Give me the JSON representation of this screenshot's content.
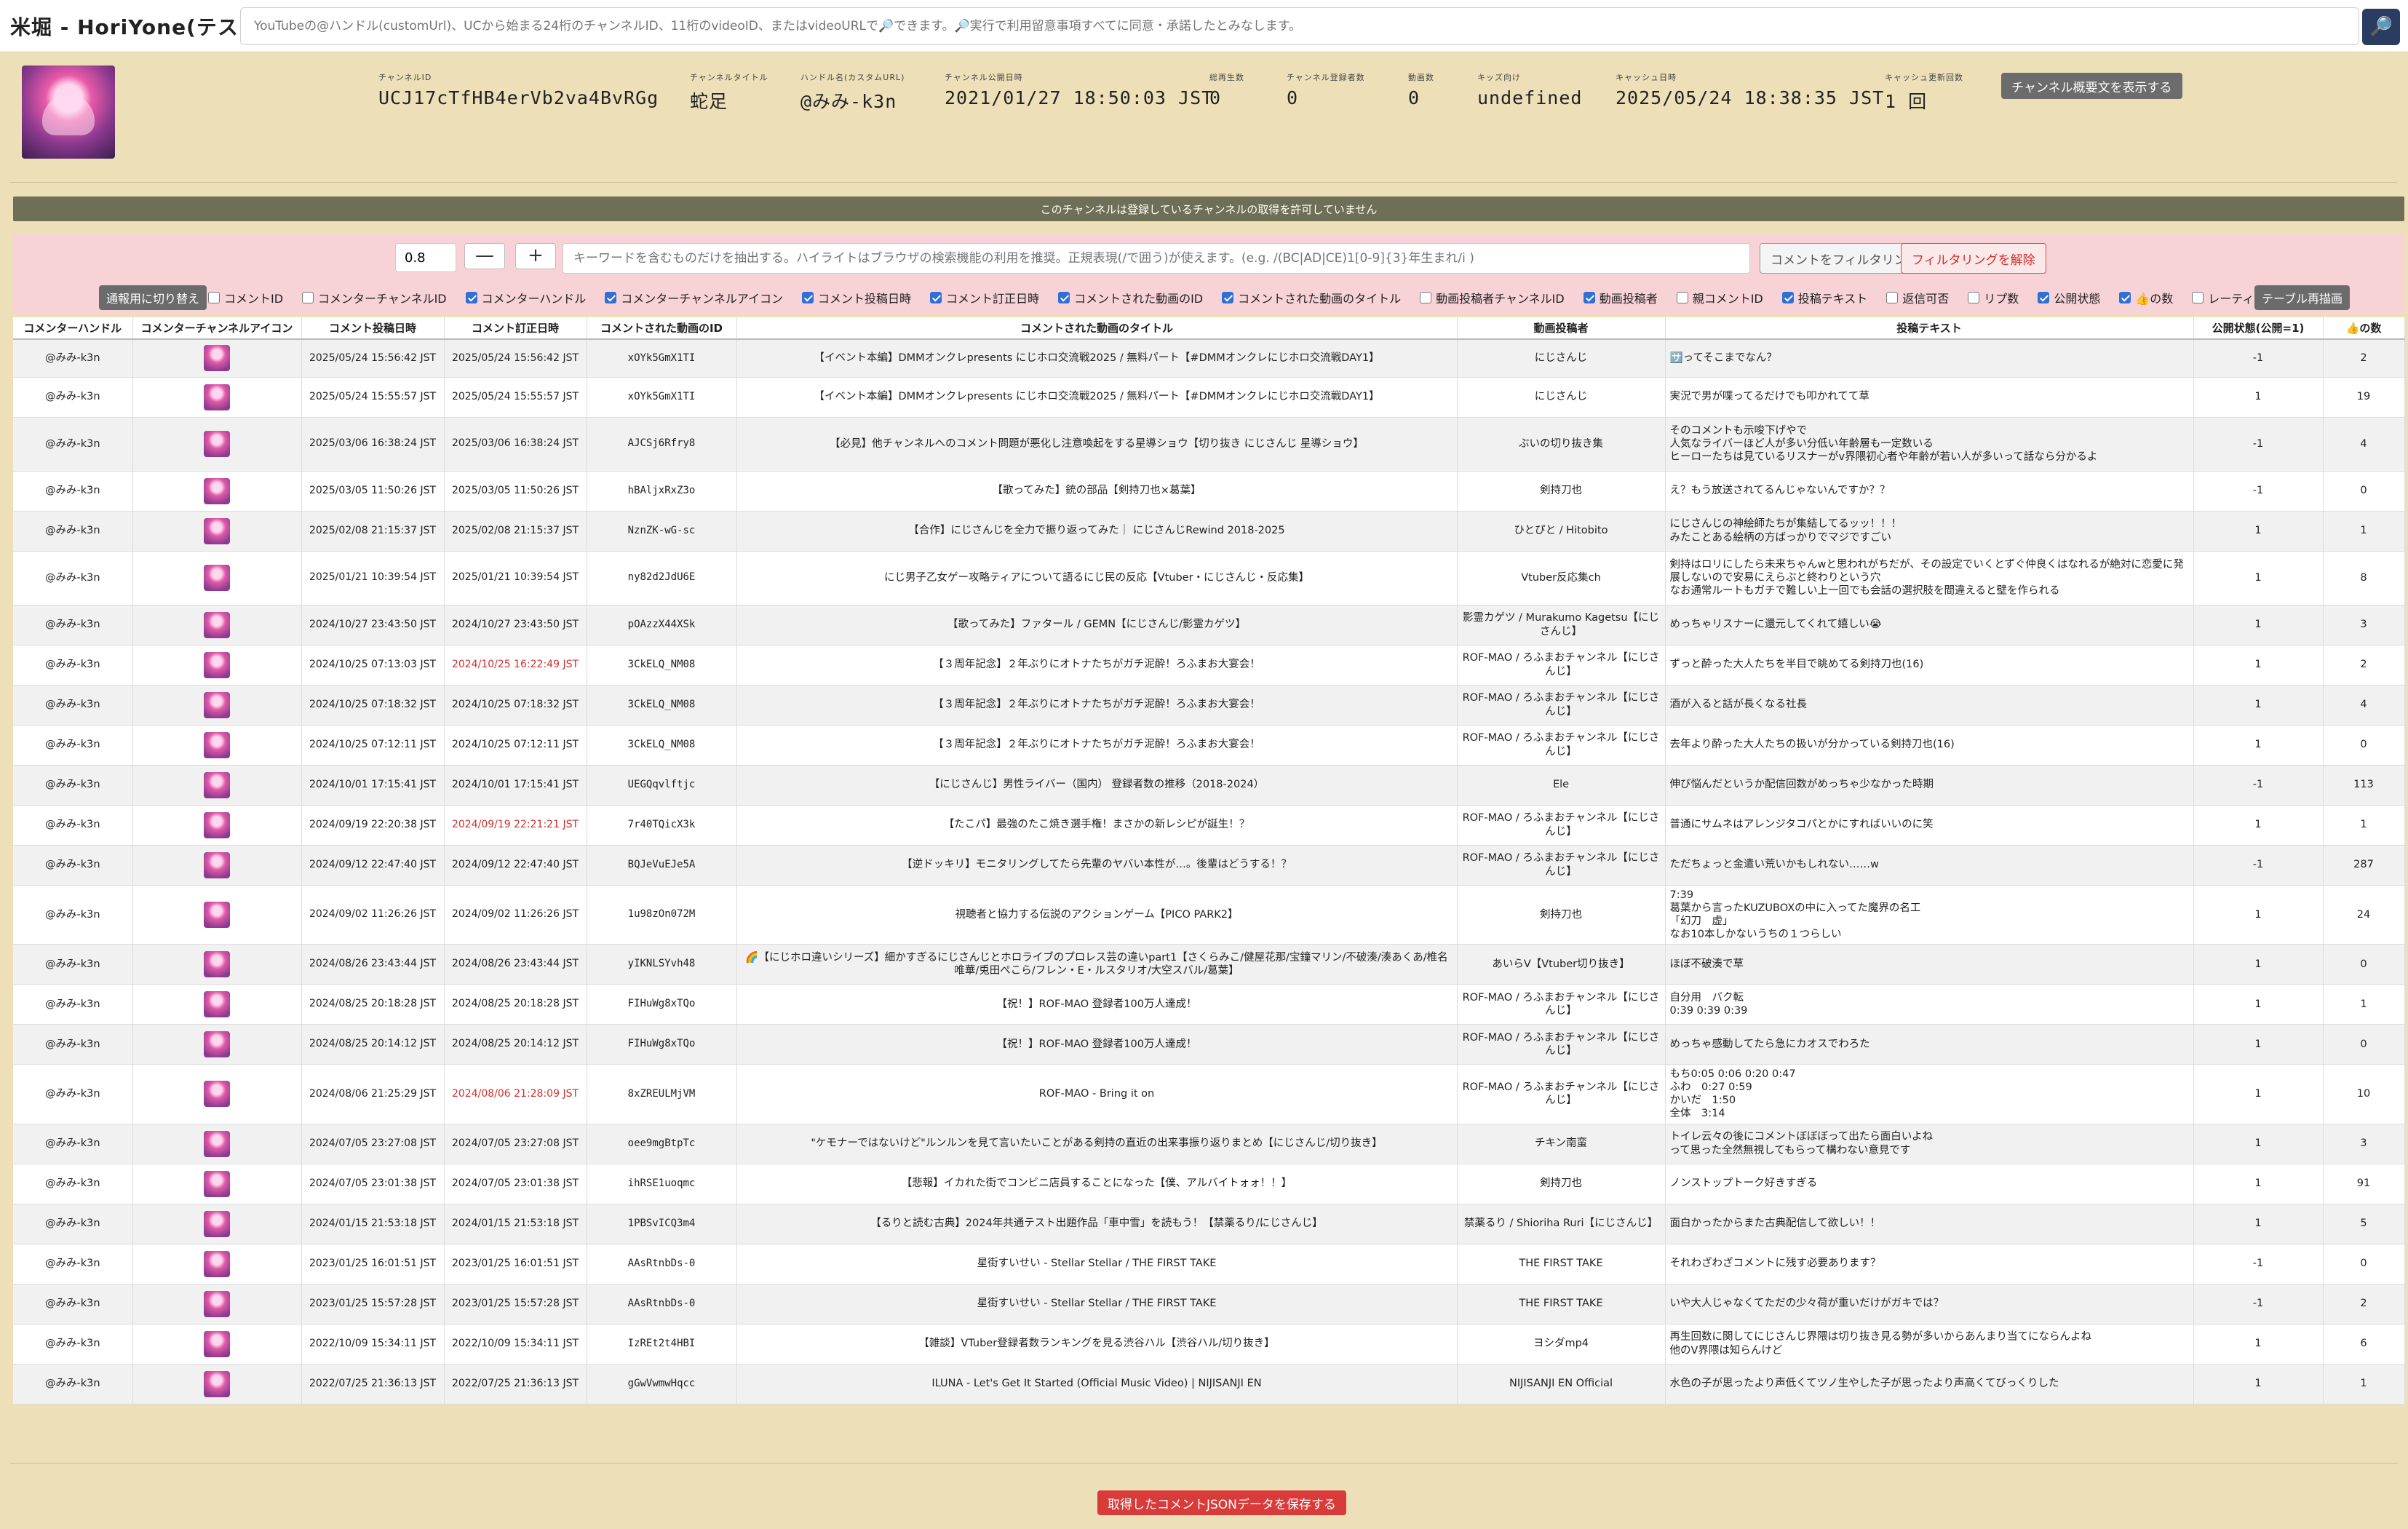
{
  "app": {
    "title": "米堀 - HoriYone(テスト中)"
  },
  "search": {
    "placeholder": "YouTubeの@ハンドル(customUrl)、UCから始まる24桁のチャンネルID、11桁のvideoID、またはvideoURLで🔎できます。🔎実行で利用留意事項すべてに同意・承諾したとみなします。",
    "button_icon": "🔎"
  },
  "channel": {
    "items": [
      {
        "label": "チャンネルID",
        "value": "UCJ17cTfHB4erVb2va4BvRGg"
      },
      {
        "label": "チャンネルタイトル",
        "value": "蛇足"
      },
      {
        "label": "ハンドル名(カスタムURL)",
        "value": "@みみ-k3n"
      },
      {
        "label": "チャンネル公開日時",
        "value": "2021/01/27 18:50:03 JST"
      },
      {
        "label": "総再生数",
        "value": "0"
      },
      {
        "label": "チャンネル登録者数",
        "value": "0"
      },
      {
        "label": "動画数",
        "value": "0"
      },
      {
        "label": "キッズ向け",
        "value": "undefined"
      },
      {
        "label": "キャッシュ日時",
        "value": "2025/05/24 18:38:35 JST"
      },
      {
        "label": "キャッシュ更新回数",
        "value": "1 回"
      }
    ],
    "desc_button": "チャンネル概要文を表示する"
  },
  "notice": "このチャンネルは登録しているチャンネルの取得を許可していません",
  "filter": {
    "zoom": "0.8",
    "minus": "—",
    "plus": "+",
    "keyword_placeholder": "キーワードを含むものだけを抽出する。ハイライトはブラウザの検索機能の利用を推奨。正規表現(/で囲う)が使えます。(e.g. /(BC|AD|CE)1[0-9]{3}年生まれ/i )",
    "filter_button": "コメントをフィルタリング",
    "unfilter_button": "フィルタリングを解除",
    "toggle_button": "通報用に切り替え",
    "redraw_button": "テーブル再描画",
    "options": [
      {
        "label": "コメントID",
        "checked": false
      },
      {
        "label": "コメンターチャンネルID",
        "checked": false
      },
      {
        "label": "コメンターハンドル",
        "checked": true
      },
      {
        "label": "コメンターチャンネルアイコン",
        "checked": true
      },
      {
        "label": "コメント投稿日時",
        "checked": true
      },
      {
        "label": "コメント訂正日時",
        "checked": true
      },
      {
        "label": "コメントされた動画のID",
        "checked": true
      },
      {
        "label": "コメントされた動画のタイトル",
        "checked": true
      },
      {
        "label": "動画投稿者チャンネルID",
        "checked": false
      },
      {
        "label": "動画投稿者",
        "checked": true
      },
      {
        "label": "親コメントID",
        "checked": false
      },
      {
        "label": "投稿テキスト",
        "checked": true
      },
      {
        "label": "返信可否",
        "checked": false
      },
      {
        "label": "リプ数",
        "checked": false
      },
      {
        "label": "公開状態",
        "checked": true
      },
      {
        "label": "👍の数",
        "checked": true
      },
      {
        "label": "レーティング",
        "checked": false
      }
    ]
  },
  "table": {
    "headers": [
      "コメンターハンドル",
      "コメンターチャンネルアイコン",
      "コメント投稿日時",
      "コメント訂正日時",
      "コメントされた動画のID",
      "コメントされた動画のタイトル",
      "動画投稿者",
      "投稿テキスト",
      "公開状態(公開=1)",
      "👍の数"
    ],
    "rows": [
      {
        "handle": "@みみ-k3n",
        "posted": "2025/05/24 15:56:42 JST",
        "edited": "2025/05/24 15:56:42 JST",
        "edited_red": false,
        "video_id": "xOYk5GmX1TI",
        "title": "【イベント本編】DMMオンクレpresents にじホロ交流戦2025 / 無料パート【#DMMオンクレにじホロ交流戦DAY1】",
        "uploader": "にじさんじ",
        "text": [
          "🈂️ってそこまでなん？"
        ],
        "public": "-1",
        "likes": "2"
      },
      {
        "handle": "@みみ-k3n",
        "posted": "2025/05/24 15:55:57 JST",
        "edited": "2025/05/24 15:55:57 JST",
        "edited_red": false,
        "video_id": "xOYk5GmX1TI",
        "title": "【イベント本編】DMMオンクレpresents にじホロ交流戦2025 / 無料パート【#DMMオンクレにじホロ交流戦DAY1】",
        "uploader": "にじさんじ",
        "text": [
          "実況で男が喋ってるだけでも叩かれてて草"
        ],
        "public": "1",
        "likes": "19"
      },
      {
        "handle": "@みみ-k3n",
        "posted": "2025/03/06 16:38:24 JST",
        "edited": "2025/03/06 16:38:24 JST",
        "edited_red": false,
        "video_id": "AJCSj6Rfry8",
        "title": "【必見】他チャンネルへのコメント問題が悪化し注意喚起をする星導ショウ【切り抜き にじさんじ 星導ショウ】",
        "uploader": "ぶいの切り抜き集",
        "text": [
          "そのコメントも示唆下げやで",
          "人気なライバーほど人が多い分低い年齢層も一定数いる",
          "ヒーローたちは見ているリスナーがv界隈初心者や年齢が若い人が多いって話なら分かるよ"
        ],
        "public": "-1",
        "likes": "4"
      },
      {
        "handle": "@みみ-k3n",
        "posted": "2025/03/05 11:50:26 JST",
        "edited": "2025/03/05 11:50:26 JST",
        "edited_red": false,
        "video_id": "hBAljxRxZ3o",
        "title": "【歌ってみた】銃の部品【剣持刀也×葛葉】",
        "uploader": "剣持刀也",
        "text": [
          "え？もう放送されてるんじゃないんですか？？"
        ],
        "public": "-1",
        "likes": "0"
      },
      {
        "handle": "@みみ-k3n",
        "posted": "2025/02/08 21:15:37 JST",
        "edited": "2025/02/08 21:15:37 JST",
        "edited_red": false,
        "video_id": "NznZK-wG-sc",
        "title": "【合作】にじさんじを全力で振り返ってみた｜ にじさんじRewind 2018-2025",
        "uploader": "ひとぴと / Hitobito",
        "text": [
          "にじさんじの神絵師たちが集結してるッッ！！！",
          "みたことある絵柄の方ばっかりでマジですごい"
        ],
        "public": "1",
        "likes": "1"
      },
      {
        "handle": "@みみ-k3n",
        "posted": "2025/01/21 10:39:54 JST",
        "edited": "2025/01/21 10:39:54 JST",
        "edited_red": false,
        "video_id": "ny82d2JdU6E",
        "title": "にじ男子乙女ゲー攻略ティアについて語るにじ民の反応【Vtuber・にじさんじ・反応集】",
        "uploader": "Vtuber反応集ch",
        "text": [
          "剣持はロリにしたら未来ちゃんwと思われがちだが、その設定でいくとずぐ仲良くはなれるが絶対に恋愛に発展しないので安易にえらぶと終わりという穴",
          "なお通常ルートもガチで難しい上一回でも会話の選択肢を間違えると壁を作られる"
        ],
        "public": "1",
        "likes": "8"
      },
      {
        "handle": "@みみ-k3n",
        "posted": "2024/10/27 23:43:50 JST",
        "edited": "2024/10/27 23:43:50 JST",
        "edited_red": false,
        "video_id": "pOAzzX44XSk",
        "title": "【歌ってみた】ファタール / GEMN【にじさんじ/影霊カゲツ】",
        "uploader": "影霊カゲツ / Murakumo Kagetsu【にじさんじ】",
        "text": [
          "めっちゃリスナーに還元してくれて嬉しい😭"
        ],
        "public": "1",
        "likes": "3"
      },
      {
        "handle": "@みみ-k3n",
        "posted": "2024/10/25 07:13:03 JST",
        "edited": "2024/10/25 16:22:49 JST",
        "edited_red": true,
        "video_id": "3CkELQ_NM08",
        "title": "【３周年記念】２年ぶりにオトナたちがガチ泥酔！ろふまお大宴会！",
        "uploader": "ROF-MAO / ろふまおチャンネル【にじさんじ】",
        "text": [
          "ずっと酔った大人たちを半目で眺めてる剣持刀也(16)"
        ],
        "public": "1",
        "likes": "2"
      },
      {
        "handle": "@みみ-k3n",
        "posted": "2024/10/25 07:18:32 JST",
        "edited": "2024/10/25 07:18:32 JST",
        "edited_red": false,
        "video_id": "3CkELQ_NM08",
        "title": "【３周年記念】２年ぶりにオトナたちがガチ泥酔！ろふまお大宴会！",
        "uploader": "ROF-MAO / ろふまおチャンネル【にじさんじ】",
        "text": [
          "酒が入ると話が長くなる社長"
        ],
        "public": "1",
        "likes": "4"
      },
      {
        "handle": "@みみ-k3n",
        "posted": "2024/10/25 07:12:11 JST",
        "edited": "2024/10/25 07:12:11 JST",
        "edited_red": false,
        "video_id": "3CkELQ_NM08",
        "title": "【３周年記念】２年ぶりにオトナたちがガチ泥酔！ろふまお大宴会！",
        "uploader": "ROF-MAO / ろふまおチャンネル【にじさんじ】",
        "text": [
          "去年より酔った大人たちの扱いが分かっている剣持刀也(16)"
        ],
        "public": "1",
        "likes": "0"
      },
      {
        "handle": "@みみ-k3n",
        "posted": "2024/10/01 17:15:41 JST",
        "edited": "2024/10/01 17:15:41 JST",
        "edited_red": false,
        "video_id": "UEGQqvlftjc",
        "title": "【にじさんじ】男性ライバー（国内） 登録者数の推移（2018-2024）",
        "uploader": "Ele",
        "text": [
          "伸び悩んだというか配信回数がめっちゃ少なかった時期"
        ],
        "public": "-1",
        "likes": "113"
      },
      {
        "handle": "@みみ-k3n",
        "posted": "2024/09/19 22:20:38 JST",
        "edited": "2024/09/19 22:21:21 JST",
        "edited_red": true,
        "video_id": "7r40TQicX3k",
        "title": "【たこパ】最強のたこ焼き選手権！まさかの新レシピが誕生！？",
        "uploader": "ROF-MAO / ろふまおチャンネル【にじさんじ】",
        "text": [
          "普通にサムネはアレンジタコパとかにすればいいのに笑"
        ],
        "public": "1",
        "likes": "1"
      },
      {
        "handle": "@みみ-k3n",
        "posted": "2024/09/12 22:47:40 JST",
        "edited": "2024/09/12 22:47:40 JST",
        "edited_red": false,
        "video_id": "BQJeVuEJe5A",
        "title": "【逆ドッキリ】モニタリングしてたら先輩のヤバい本性が…。後輩はどうする！？",
        "uploader": "ROF-MAO / ろふまおチャンネル【にじさんじ】",
        "text": [
          "ただちょっと金遣い荒いかもしれない……w"
        ],
        "public": "-1",
        "likes": "287"
      },
      {
        "handle": "@みみ-k3n",
        "posted": "2024/09/02 11:26:26 JST",
        "edited": "2024/09/02 11:26:26 JST",
        "edited_red": false,
        "video_id": "1u98zOn072M",
        "title": "視聴者と協力する伝説のアクションゲーム【PICO PARK2】",
        "uploader": "剣持刀也",
        "text": [
          "7:39",
          "葛葉から言ったKUZUBOXの中に入ってた魔界の名工",
          "「幻刀　虚」",
          "なお10本しかないうちの１つらしい"
        ],
        "public": "1",
        "likes": "24"
      },
      {
        "handle": "@みみ-k3n",
        "posted": "2024/08/26 23:43:44 JST",
        "edited": "2024/08/26 23:43:44 JST",
        "edited_red": false,
        "video_id": "yIKNLSYvh48",
        "title": "🌈【にじホロ違いシリーズ】細かすぎるにじさんじとホロライブのプロレス芸の違いpart1【さくらみこ/健屋花那/宝鐘マリン/不破湊/湊あくあ/椎名唯華/兎田ぺこら/フレン・E・ルスタリオ/大空スバル/葛葉】",
        "uploader": "あいらV【Vtuber切り抜き】",
        "text": [
          "ほぼ不破湊で草"
        ],
        "public": "1",
        "likes": "0"
      },
      {
        "handle": "@みみ-k3n",
        "posted": "2024/08/25 20:18:28 JST",
        "edited": "2024/08/25 20:18:28 JST",
        "edited_red": false,
        "video_id": "FIHuWg8xTQo",
        "title": "【祝！】ROF-MAO 登録者100万人達成！",
        "uploader": "ROF-MAO / ろふまおチャンネル【にじさんじ】",
        "text": [
          "自分用　バク転",
          "0:39 0:39 0:39"
        ],
        "public": "1",
        "likes": "1"
      },
      {
        "handle": "@みみ-k3n",
        "posted": "2024/08/25 20:14:12 JST",
        "edited": "2024/08/25 20:14:12 JST",
        "edited_red": false,
        "video_id": "FIHuWg8xTQo",
        "title": "【祝！】ROF-MAO 登録者100万人達成！",
        "uploader": "ROF-MAO / ろふまおチャンネル【にじさんじ】",
        "text": [
          "めっちゃ感動してたら急にカオスでわろた"
        ],
        "public": "1",
        "likes": "0"
      },
      {
        "handle": "@みみ-k3n",
        "posted": "2024/08/06 21:25:29 JST",
        "edited": "2024/08/06 21:28:09 JST",
        "edited_red": true,
        "video_id": "8xZREULMjVM",
        "title": "ROF-MAO - Bring it on",
        "uploader": "ROF-MAO / ろふまおチャンネル【にじさんじ】",
        "text": [
          "もち0:05 0:06 0:20 0:47",
          "ふわ　0:27 0:59",
          "かいだ　1:50",
          "全体　3:14"
        ],
        "public": "1",
        "likes": "10"
      },
      {
        "handle": "@みみ-k3n",
        "posted": "2024/07/05 23:27:08 JST",
        "edited": "2024/07/05 23:27:08 JST",
        "edited_red": false,
        "video_id": "oee9mgBtpTc",
        "title": "\"ケモナーではないけど\"ルンルンを見て言いたいことがある剣持の直近の出来事振り返りまとめ【にじさんじ/切り抜き】",
        "uploader": "チキン南蛮",
        "text": [
          "トイレ云々の後にコメントぼぼぼって出たら面白いよね",
          "って思った全然無視してもらって構わない意見です"
        ],
        "public": "1",
        "likes": "3"
      },
      {
        "handle": "@みみ-k3n",
        "posted": "2024/07/05 23:01:38 JST",
        "edited": "2024/07/05 23:01:38 JST",
        "edited_red": false,
        "video_id": "ihRSE1uoqmc",
        "title": "【悲報】イカれた街でコンビニ店員することになった【僕、アルバイトォォ！！】",
        "uploader": "剣持刀也",
        "text": [
          "ノンストップトーク好きすぎる"
        ],
        "public": "1",
        "likes": "91"
      },
      {
        "handle": "@みみ-k3n",
        "posted": "2024/01/15 21:53:18 JST",
        "edited": "2024/01/15 21:53:18 JST",
        "edited_red": false,
        "video_id": "1PBSvICQ3m4",
        "title": "【るりと読む古典】2024年共通テスト出題作品「車中雪」を読もう！【禁薬るり/にじさんじ】",
        "uploader": "禁薬るり / Shioriha Ruri【にじさんじ】",
        "text": [
          "面白かったからまた古典配信して欲しい！！"
        ],
        "public": "1",
        "likes": "5"
      },
      {
        "handle": "@みみ-k3n",
        "posted": "2023/01/25 16:01:51 JST",
        "edited": "2023/01/25 16:01:51 JST",
        "edited_red": false,
        "video_id": "AAsRtnbDs-0",
        "title": "星街すいせい - Stellar Stellar / THE FIRST TAKE",
        "uploader": "THE FIRST TAKE",
        "text": [
          "それわざわざコメントに残す必要あります？"
        ],
        "public": "-1",
        "likes": "0"
      },
      {
        "handle": "@みみ-k3n",
        "posted": "2023/01/25 15:57:28 JST",
        "edited": "2023/01/25 15:57:28 JST",
        "edited_red": false,
        "video_id": "AAsRtnbDs-0",
        "title": "星街すいせい - Stellar Stellar / THE FIRST TAKE",
        "uploader": "THE FIRST TAKE",
        "text": [
          "いや大人じゃなくてただの少々荷が重いだけがガキでは？"
        ],
        "public": "-1",
        "likes": "2"
      },
      {
        "handle": "@みみ-k3n",
        "posted": "2022/10/09 15:34:11 JST",
        "edited": "2022/10/09 15:34:11 JST",
        "edited_red": false,
        "video_id": "IzREt2t4HBI",
        "title": "【雑談】VTuber登録者数ランキングを見る渋谷ハル【渋谷ハル/切り抜き】",
        "uploader": "ヨシダmp4",
        "text": [
          "再生回数に関してにじさんじ界隈は切り抜き見る勢が多いからあんまり当てにならんよね",
          "他のV界隈は知らんけど"
        ],
        "public": "1",
        "likes": "6"
      },
      {
        "handle": "@みみ-k3n",
        "posted": "2022/07/25 21:36:13 JST",
        "edited": "2022/07/25 21:36:13 JST",
        "edited_red": false,
        "video_id": "gGwVwmwHqcc",
        "title": "ILUNA - Let's Get It Started (Official Music Video) | NIJISANJI EN",
        "uploader": "NIJISANJI EN Official",
        "text": [
          "水色の子が思ったより声低くてツノ生やした子が思ったより声高くてびっくりした"
        ],
        "public": "1",
        "likes": "1"
      }
    ]
  },
  "save_button": "取得したコメントJSONデータを保存する"
}
